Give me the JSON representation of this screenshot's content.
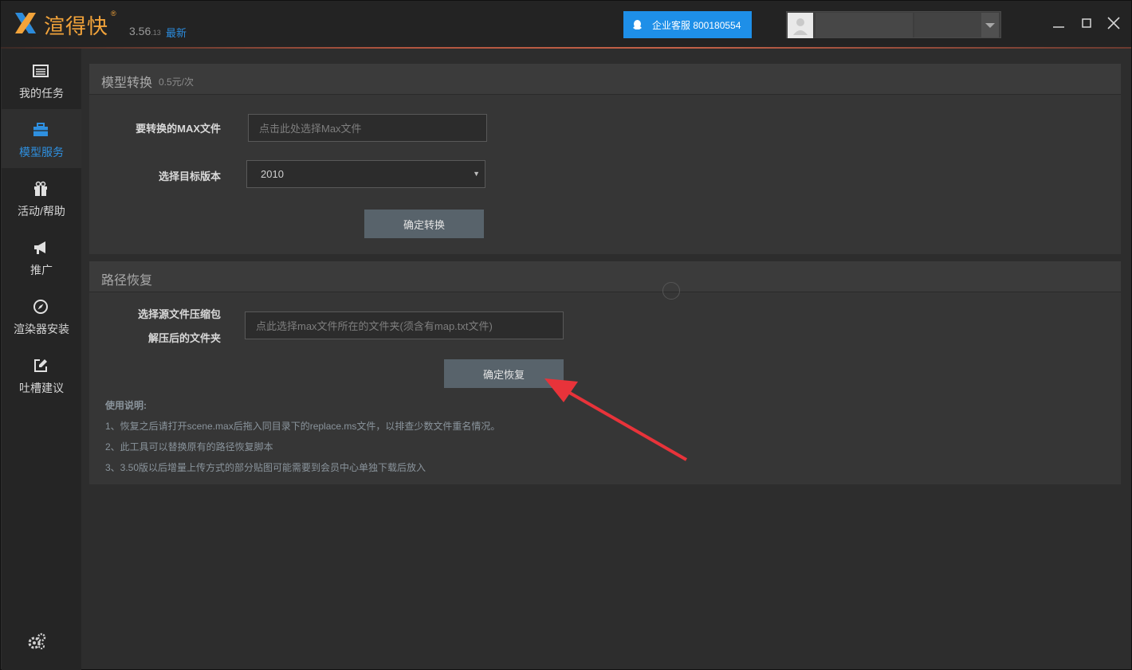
{
  "app": {
    "name": "渲得快",
    "reg_mark": "®",
    "version": "3.56",
    "version_sub": ".13",
    "version_tag": "最新"
  },
  "header": {
    "support_label": "企业客服 800180554",
    "colors": {
      "support_bg": "#1e8fe8",
      "accent_line": "#c46148"
    }
  },
  "sidebar": {
    "items": [
      {
        "label": "我的任务",
        "icon": "task-list-icon",
        "active": false
      },
      {
        "label": "模型服务",
        "icon": "briefcase-icon",
        "active": true
      },
      {
        "label": "活动/帮助",
        "icon": "gift-icon",
        "active": false
      },
      {
        "label": "推广",
        "icon": "megaphone-icon",
        "active": false
      },
      {
        "label": "渲染器安装",
        "icon": "compass-icon",
        "active": false
      },
      {
        "label": "吐槽建议",
        "icon": "edit-icon",
        "active": false
      }
    ],
    "settings_icon": "gears-icon",
    "active_color": "#2f90e0"
  },
  "convert": {
    "title": "模型转换",
    "price": "0.5元/次",
    "file_label": "要转换的MAX文件",
    "file_placeholder": "点击此处选择Max文件",
    "version_label": "选择目标版本",
    "version_value": "2010",
    "submit_label": "确定转换"
  },
  "restore": {
    "title": "路径恢复",
    "source_label_line1": "选择源文件压缩包",
    "source_label_line2": "解压后的文件夹",
    "source_placeholder": "点此选择max文件所在的文件夹(须含有map.txt文件)",
    "submit_label": "确定恢复",
    "notes_title": "使用说明:",
    "notes": [
      "1、恢复之后请打开scene.max后拖入同目录下的replace.ms文件，以排查少数文件重名情况。",
      "2、此工具可以替换原有的路径恢复脚本",
      "3、3.50版以后增量上传方式的部分贴图可能需要到会员中心单独下载后放入"
    ]
  }
}
